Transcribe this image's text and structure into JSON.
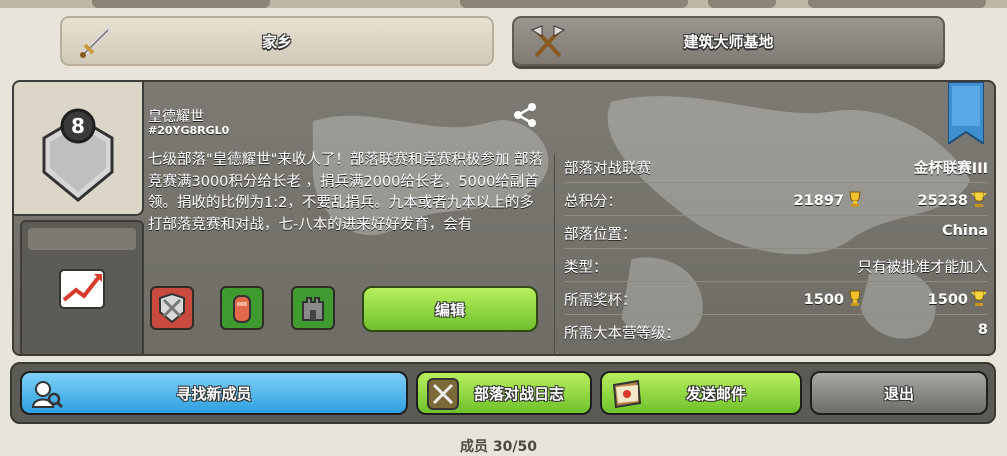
{
  "top_tabs": {
    "home_label": "家乡",
    "builder_label": "建筑大师基地"
  },
  "clan": {
    "level": "8",
    "name": "皇德耀世",
    "tag": "#20YG8RGL0",
    "description": "七级部落\"皇德耀世\"来收人了！部落联赛和竞赛积极参加 部落竞赛满3000积分给长老 ，捐兵满2000给长老，5000给副首领。捐收的比例为1:2，不要乱捐兵。九本或者九本以上的多打部落竞赛和对战，七-八本的进来好好发育，会有"
  },
  "info_rows": [
    {
      "label": "部落对战联赛",
      "value": "金杯联赛III"
    },
    {
      "label": "总积分：",
      "value1": "21897",
      "value": "25238"
    },
    {
      "label": "部落位置：",
      "value": "China"
    },
    {
      "label": "类型：",
      "value": "只有被批准才能加入"
    },
    {
      "label": "所需奖杯：",
      "value1": "1500",
      "value": "1500"
    },
    {
      "label": "所需大本营等级：",
      "value": "8"
    }
  ],
  "buttons": {
    "edit": "编辑",
    "find_members": "寻找新成员",
    "war_log": "部落对战日志",
    "send_mail": "发送邮件",
    "leave": "退出"
  },
  "footer": {
    "members": "成员 30/50"
  },
  "colors": {
    "green_button": "#6fc12c",
    "blue_button": "#2ea0e0",
    "gray_button": "#6d6c68",
    "panel": "#74726b",
    "ribbon": "#3f8fd0"
  },
  "icons": [
    "sword-icon",
    "builder-axes-icon",
    "clan-shield-icon",
    "share-icon",
    "stats-chart-icon",
    "ribbon-icon",
    "trophy-icon",
    "builder-trophy-icon",
    "war-league-badge-icon",
    "perk-badge-icon",
    "castle-badge-icon",
    "search-members-icon",
    "war-swords-icon",
    "mail-icon"
  ]
}
